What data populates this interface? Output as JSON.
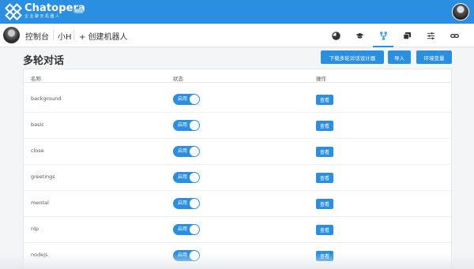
{
  "header": {
    "brand": "Chatopera",
    "brand_sub": "企业聊天机器人",
    "beta": "Beta"
  },
  "nav": {
    "console": "控制台",
    "bot_name": "小H",
    "create_bot": "+ 创建机器人",
    "icons": [
      "pie-chart-icon",
      "graduation-cap-icon",
      "flow-branch-icon",
      "chat-bubbles-icon",
      "sliders-icon",
      "link-icon"
    ],
    "active_icon": "flow-branch-icon"
  },
  "page": {
    "title": "多轮对话",
    "buttons": {
      "download": "下载多轮对话设计器",
      "import": "导入",
      "env": "环境变量"
    }
  },
  "table": {
    "headers": {
      "name": "名称",
      "status": "状态",
      "action": "操作"
    },
    "toggle_label": "启用",
    "view_label": "查看",
    "rows": [
      "background",
      "basic",
      "close",
      "greetings",
      "mental",
      "nlp",
      "nodejs"
    ]
  },
  "colors": {
    "primary": "#2a8fe0"
  }
}
